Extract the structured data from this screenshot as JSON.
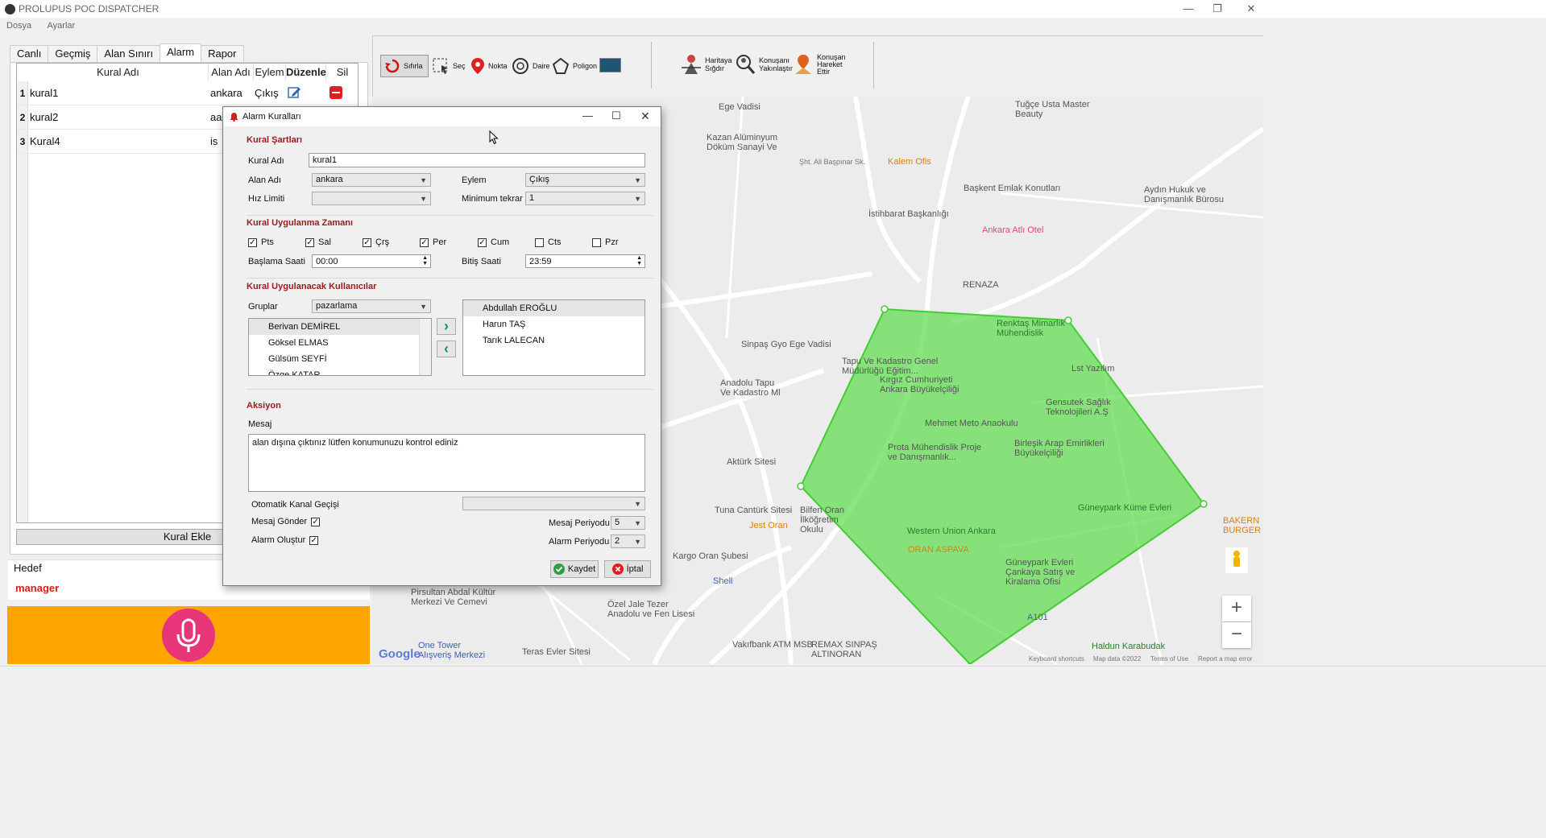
{
  "app": {
    "title": "PROLUPUS POC DISPATCHER"
  },
  "menu": [
    {
      "label": "Dosya"
    },
    {
      "label": "Ayarlar"
    }
  ],
  "window_controls": [
    "—",
    "❐",
    "✕"
  ],
  "tabs": [
    {
      "label": "Canlı"
    },
    {
      "label": "Geçmiş"
    },
    {
      "label": "Alan Sınırı"
    },
    {
      "label": "Alarm"
    },
    {
      "label": "Rapor"
    }
  ],
  "rules_table": {
    "columns": [
      "Kural Adı",
      "Alan Adı",
      "Eylem",
      "Düzenle",
      "Sil"
    ],
    "rows": [
      {
        "num": "1",
        "name": "kural1",
        "area": "ankara",
        "action": "Çıkış"
      },
      {
        "num": "2",
        "name": "kural2",
        "area": "aa",
        "action": ""
      },
      {
        "num": "3",
        "name": "Kural4",
        "area": "is",
        "action": ""
      }
    ]
  },
  "kural_ekle": "Kural Ekle",
  "hedef": {
    "label": "Hedef",
    "value": "manager"
  },
  "toolbar": {
    "reset": "Sıfırla",
    "select": "Seç",
    "point": "Nokta",
    "circle": "Daire",
    "polygon": "Poligon",
    "fit": "Haritaya Sığdır",
    "zoom_to_speaker": "Konuşanı Yakınlaştır",
    "follow_speaker": "Konuşan Hareket Ettir"
  },
  "dialog": {
    "title": "Alarm Kuralları",
    "rule_conditions": {
      "title": "Kural Şartları",
      "rule_name_label": "Kural Adı",
      "rule_name_value": "kural1",
      "area_label": "Alan Adı",
      "area_value": "ankara",
      "action_label": "Eylem",
      "action_value": "Çıkış",
      "speed_label": "Hız Limiti",
      "speed_value": "",
      "min_repeat_label": "Minimum tekrar",
      "min_repeat_value": "1"
    },
    "schedule": {
      "title": "Kural Uygulanma Zamanı",
      "days": [
        {
          "label": "Pts",
          "checked": true
        },
        {
          "label": "Sal",
          "checked": true
        },
        {
          "label": "Çrş",
          "checked": true
        },
        {
          "label": "Per",
          "checked": true
        },
        {
          "label": "Cum",
          "checked": true
        },
        {
          "label": "Cts",
          "checked": false
        },
        {
          "label": "Pzr",
          "checked": false
        }
      ],
      "start_label": "Başlama Saati",
      "start_value": "00:00",
      "end_label": "Bitiş Saati",
      "end_value": "23:59"
    },
    "users": {
      "title": "Kural Uygulanacak Kullanıcılar",
      "groups_label": "Gruplar",
      "groups_value": "pazarlama",
      "available": [
        "Berivan DEMİREL",
        "Göksel ELMAS",
        "Gülsüm SEYFİ",
        "Özge KATAR"
      ],
      "selected": [
        "Abdullah EROĞLU",
        "Harun TAŞ",
        "Tarık LALECAN"
      ]
    },
    "action": {
      "title": "Aksiyon",
      "message_label": "Mesaj",
      "message_value": "alan dışına çıktınız lütfen konumunuzu kontrol ediniz",
      "auto_channel_label": "Otomatik Kanal Geçişi",
      "auto_channel_value": "",
      "send_message_label": "Mesaj Gönder",
      "create_alarm_label": "Alarm Oluştur",
      "message_period_label": "Mesaj Periyodu",
      "message_period_value": "5",
      "alarm_period_label": "Alarm Periyodu",
      "alarm_period_value": "2"
    },
    "save_label": "Kaydet",
    "cancel_label": "İptal"
  },
  "map": {
    "labels": [
      "Ege Vadisi",
      "Tuğçe Usta Master Beauty",
      "Kazan Alüminyum Döküm Sanayi Ve",
      "Kalem Ofis",
      "Şht. Ali Başpınar Sk.",
      "Başkent Emlak Konutları",
      "Aydın Hukuk ve Danışmanlık Bürosu",
      "İstihbarat Başkanlığı",
      "Ankara Atlı Otel",
      "RENAZA",
      "Renktaş Mimarlık Mühendislik",
      "Tapu Ve Kadastro Genel Müdürlüğü Eğitim...",
      "Lst Yazılım",
      "Kırgız Cumhuriyeti Ankara Büyükelçiliği",
      "Gensutek Sağlık Teknolojileri A.Ş",
      "Mehmet Meto Anaokulu",
      "Prota Mühendislik Proje ve Danışmanlık...",
      "Birleşik Arap Emirlikleri Büyükelçiliği",
      "Sinpaş Gyo Ege Vadisi",
      "Anadolu Tapu Ve Kadastro Ml",
      "Aktürk Sitesi",
      "Tuna Cantürk Sitesi",
      "Bilfen Oran İlköğretim Okulu",
      "Güneypark Küme Evleri",
      "Western Union Ankara",
      "ORAN ASPAVA",
      "Güneypark Evleri Çankaya Satış ve Kiralama Ofisi",
      "Jest Oran",
      "Kargo Oran Şubesi",
      "Shell",
      "Pirsultan Abdal Kültür Merkezi Ve Cemevi",
      "Özel Jale Tezer Anadolu ve Fen Lisesi",
      "One Tower Alışveriş Merkezi",
      "Teras Evler Sitesi",
      "Vakıfbank ATM MSB",
      "REMAX SINPAŞ ALTINORAN",
      "Haldun Karabudak",
      "BAKERN BURGER",
      "A101",
      "Keyboard shortcuts",
      "Map data ©2022",
      "Terms of Use",
      "Report a map error",
      "Google"
    ]
  },
  "colors": {
    "accent_red": "#9b1b1b",
    "mic_bg": "#ffa500",
    "mic_btn": "#e8357a",
    "geofence": "#66dd55"
  }
}
